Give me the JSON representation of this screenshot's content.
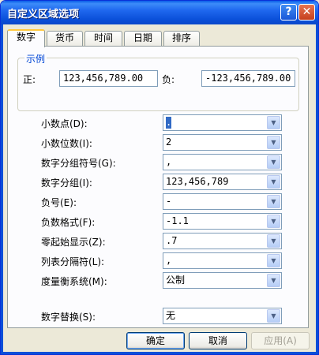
{
  "window": {
    "title": "自定义区域选项",
    "help_symbol": "?",
    "close_symbol": "✕"
  },
  "tabs": [
    {
      "label": "数字",
      "active": true
    },
    {
      "label": "货币",
      "active": false
    },
    {
      "label": "时间",
      "active": false
    },
    {
      "label": "日期",
      "active": false
    },
    {
      "label": "排序",
      "active": false
    }
  ],
  "example": {
    "title": "示例",
    "positive_label": "正:",
    "positive_value": "123,456,789.00",
    "negative_label": "负:",
    "negative_value": "-123,456,789.00"
  },
  "settings": [
    {
      "label": "小数点(D):",
      "value": "."
    },
    {
      "label": "小数位数(I):",
      "value": "2"
    },
    {
      "label": "数字分组符号(G):",
      "value": ","
    },
    {
      "label": "数字分组(I):",
      "value": "123,456,789"
    },
    {
      "label": "负号(E):",
      "value": "-"
    },
    {
      "label": "负数格式(F):",
      "value": "-1.1"
    },
    {
      "label": "零起始显示(Z):",
      "value": ".7"
    },
    {
      "label": "列表分隔符(L):",
      "value": ","
    },
    {
      "label": "度量衡系统(M):",
      "value": "公制"
    }
  ],
  "digit_substitution": {
    "label": "数字替换(S):",
    "value": "无"
  },
  "buttons": {
    "ok": "确定",
    "cancel": "取消",
    "apply": "应用(A)"
  },
  "icons": {
    "dropdown": "▼"
  },
  "colors": {
    "title_bar": "#0a4fd8",
    "group_title": "#0046d5",
    "selection": "#316ac5"
  }
}
